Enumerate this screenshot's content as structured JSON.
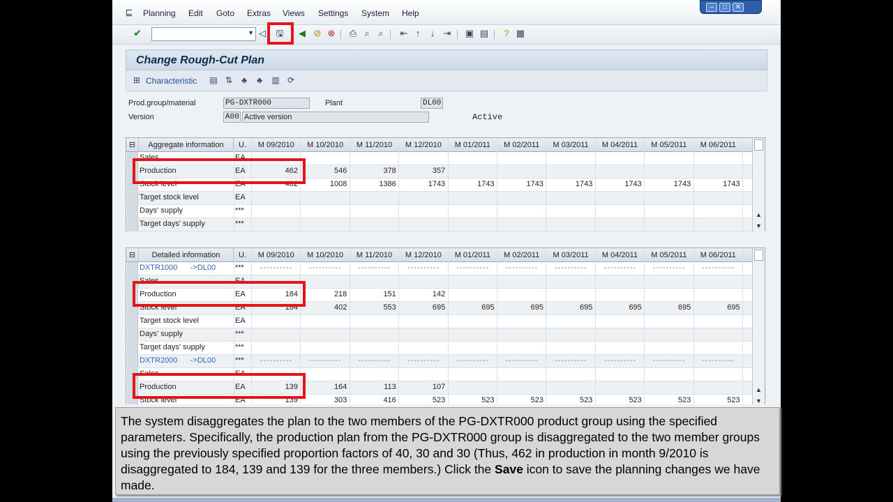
{
  "menu": {
    "items": [
      "Planning",
      "Edit",
      "Goto",
      "Extras",
      "Views",
      "Settings",
      "System",
      "Help"
    ]
  },
  "toolbar": {
    "command_value": "",
    "icons": [
      "enter-icon",
      "save-icon",
      "back-icon",
      "exit-icon",
      "cancel-icon",
      "print-icon",
      "find-icon",
      "find-next-icon",
      "first-page-icon",
      "prev-page-icon",
      "next-page-icon",
      "last-page-icon",
      "new-session-icon",
      "shortcut-icon",
      "help-icon",
      "layout-icon"
    ]
  },
  "title": "Change Rough-Cut Plan",
  "app_toolbar": {
    "characteristic_label": "Characteristic"
  },
  "header": {
    "prod_group_label": "Prod.group/material",
    "prod_group_value": "PG-DXTR000",
    "plant_label": "Plant",
    "plant_value": "DL00",
    "version_label": "Version",
    "version_code": "A00",
    "version_desc": "Active version",
    "status": "Active"
  },
  "aggregate": {
    "title": "Aggregate information",
    "unit_header": "U.",
    "months": [
      "M 09/2010",
      "M 10/2010",
      "M 11/2010",
      "M 12/2010",
      "M 01/2011",
      "M 02/2011",
      "M 03/2011",
      "M 04/2011",
      "M 05/2011",
      "M 06/2011"
    ],
    "rows": [
      {
        "label": "Sales",
        "unit": "EA",
        "values": [
          "",
          "",
          "",
          "",
          "",
          "",
          "",
          "",
          "",
          ""
        ]
      },
      {
        "label": "Production",
        "unit": "EA",
        "values": [
          "462",
          "546",
          "378",
          "357",
          "",
          "",
          "",
          "",
          "",
          ""
        ]
      },
      {
        "label": "Stock level",
        "unit": "EA",
        "values": [
          "462",
          "1008",
          "1386",
          "1743",
          "1743",
          "1743",
          "1743",
          "1743",
          "1743",
          "1743"
        ]
      },
      {
        "label": "Target stock level",
        "unit": "EA",
        "values": [
          "",
          "",
          "",
          "",
          "",
          "",
          "",
          "",
          "",
          ""
        ]
      },
      {
        "label": "Days' supply",
        "unit": "***",
        "values": [
          "",
          "",
          "",
          "",
          "",
          "",
          "",
          "",
          "",
          ""
        ]
      },
      {
        "label": "Target days' supply",
        "unit": "***",
        "values": [
          "",
          "",
          "",
          "",
          "",
          "",
          "",
          "",
          "",
          ""
        ]
      }
    ]
  },
  "detailed": {
    "title": "Detailed information",
    "unit_header": "U.",
    "months": [
      "M 09/2010",
      "M 10/2010",
      "M 11/2010",
      "M 12/2010",
      "M 01/2011",
      "M 02/2011",
      "M 03/2011",
      "M 04/2011",
      "M 05/2011",
      "M 06/2011"
    ],
    "rows": [
      {
        "label": "DXTR1000      ->DL00",
        "unit": "***",
        "kind": "member",
        "values": []
      },
      {
        "label": "Sales",
        "unit": "EA",
        "values": [
          "",
          "",
          "",
          "",
          "",
          "",
          "",
          "",
          "",
          ""
        ]
      },
      {
        "label": "Production",
        "unit": "EA",
        "values": [
          "184",
          "218",
          "151",
          "142",
          "",
          "",
          "",
          "",
          "",
          ""
        ]
      },
      {
        "label": "Stock level",
        "unit": "EA",
        "values": [
          "184",
          "402",
          "553",
          "695",
          "695",
          "695",
          "695",
          "695",
          "695",
          "695"
        ]
      },
      {
        "label": "Target stock level",
        "unit": "EA",
        "values": [
          "",
          "",
          "",
          "",
          "",
          "",
          "",
          "",
          "",
          ""
        ]
      },
      {
        "label": "Days' supply",
        "unit": "***",
        "values": [
          "",
          "",
          "",
          "",
          "",
          "",
          "",
          "",
          "",
          ""
        ]
      },
      {
        "label": "Target days' supply",
        "unit": "***",
        "values": [
          "",
          "",
          "",
          "",
          "",
          "",
          "",
          "",
          "",
          ""
        ]
      },
      {
        "label": "DXTR2000      ->DL00",
        "unit": "***",
        "kind": "member",
        "values": []
      },
      {
        "label": "Sales",
        "unit": "EA",
        "values": [
          "",
          "",
          "",
          "",
          "",
          "",
          "",
          "",
          "",
          ""
        ]
      },
      {
        "label": "Production",
        "unit": "EA",
        "values": [
          "139",
          "164",
          "113",
          "107",
          "",
          "",
          "",
          "",
          "",
          ""
        ]
      },
      {
        "label": "Stock level",
        "unit": "EA",
        "values": [
          "139",
          "303",
          "416",
          "523",
          "523",
          "523",
          "523",
          "523",
          "523",
          "523"
        ]
      }
    ]
  },
  "caption": {
    "text_before": "The system disaggregates the plan to the two members of the PG-DXTR000 product group using the specified parameters. Specifically, the production plan from the PG-DXTR000 group is disaggregated to the two member groups using the previously specified proportion factors of 40, 30 and 30 (Thus, 462 in production in month 9/2010 is disaggregated to 184, 139 and 139 for the three members.) Click the ",
    "bold": "Save",
    "text_after": " icon to save the planning changes we have made."
  },
  "colors": {
    "highlight": "#e3141a",
    "link": "#2a66b8",
    "title_text": "#102a4a"
  }
}
